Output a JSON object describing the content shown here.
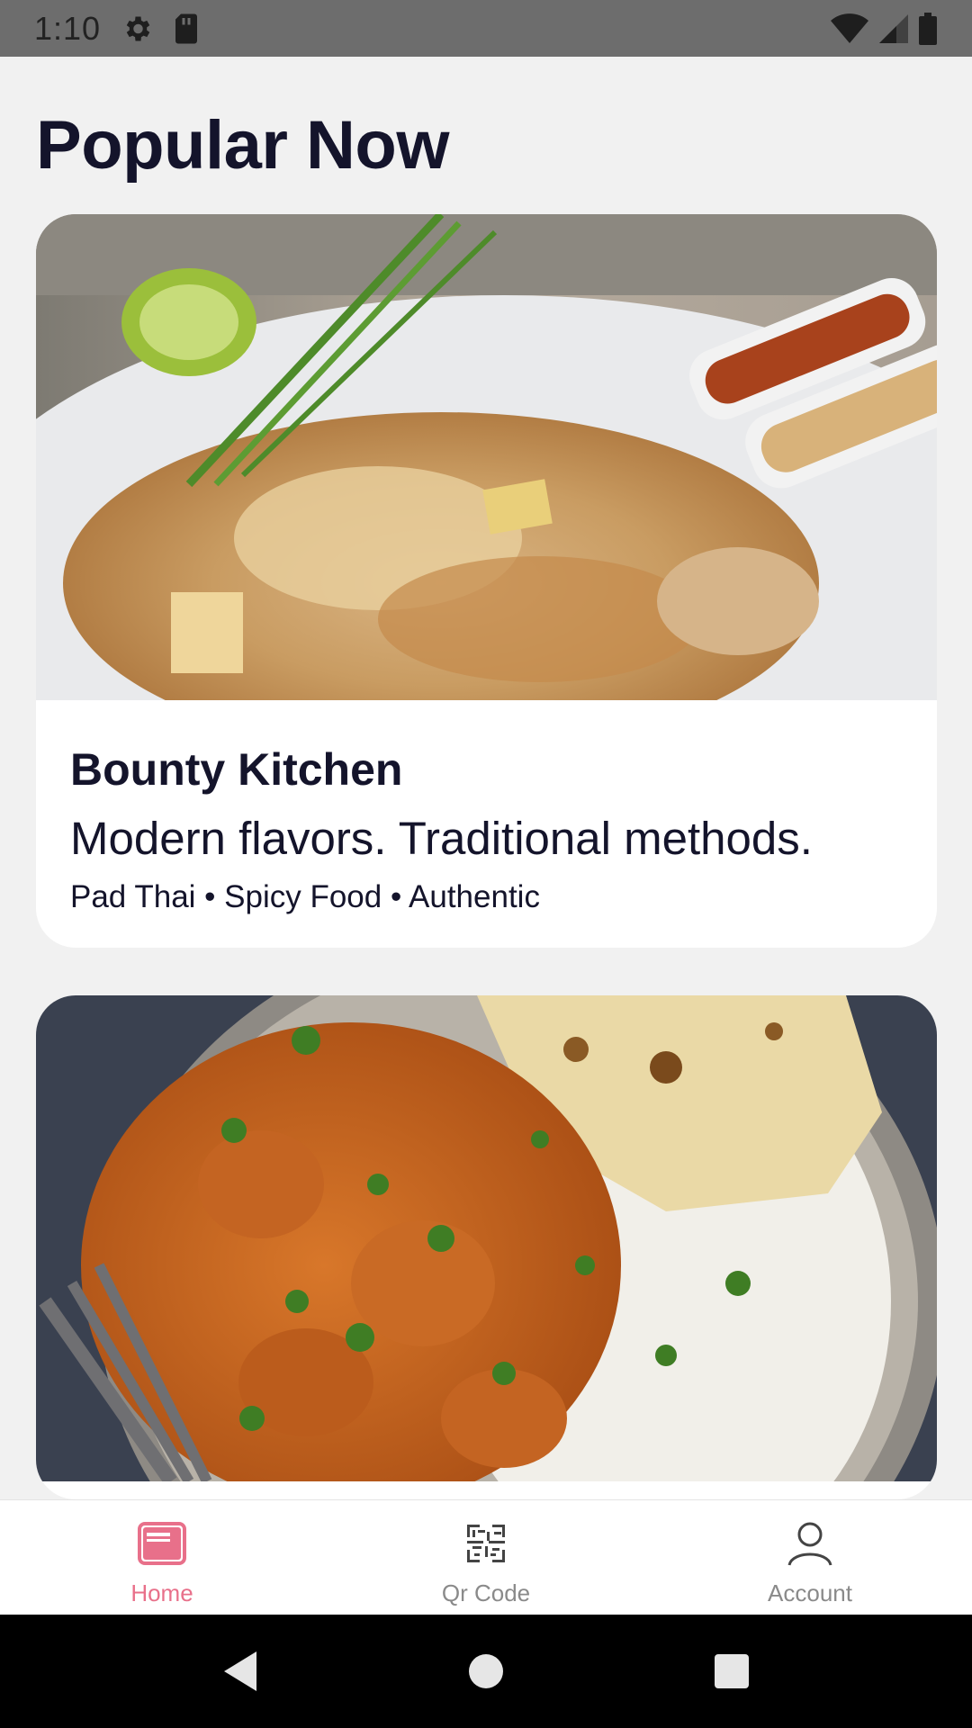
{
  "status_bar": {
    "time": "1:10",
    "icons_left": [
      "settings-icon",
      "sd-card-icon"
    ],
    "icons_right": [
      "wifi-icon",
      "cell-signal-icon",
      "battery-icon"
    ]
  },
  "page": {
    "title": "Popular Now"
  },
  "cards": [
    {
      "name": "Bounty Kitchen",
      "tagline": "Modern flavors. Traditional methods.",
      "tags": "Pad Thai • Spicy Food • Authentic",
      "image": "pad-thai-photo"
    },
    {
      "image": "butter-chicken-rice-naan-photo"
    }
  ],
  "bottom_nav": {
    "items": [
      {
        "label": "Home",
        "icon": "home-card-icon",
        "active": true
      },
      {
        "label": "Qr Code",
        "icon": "qr-code-icon",
        "active": false
      },
      {
        "label": "Account",
        "icon": "account-icon",
        "active": false
      }
    ],
    "active_color": "#e8708a",
    "inactive_color": "#8a8a8a"
  },
  "system_nav": {
    "buttons": [
      "back-icon",
      "home-icon",
      "recents-icon"
    ]
  }
}
